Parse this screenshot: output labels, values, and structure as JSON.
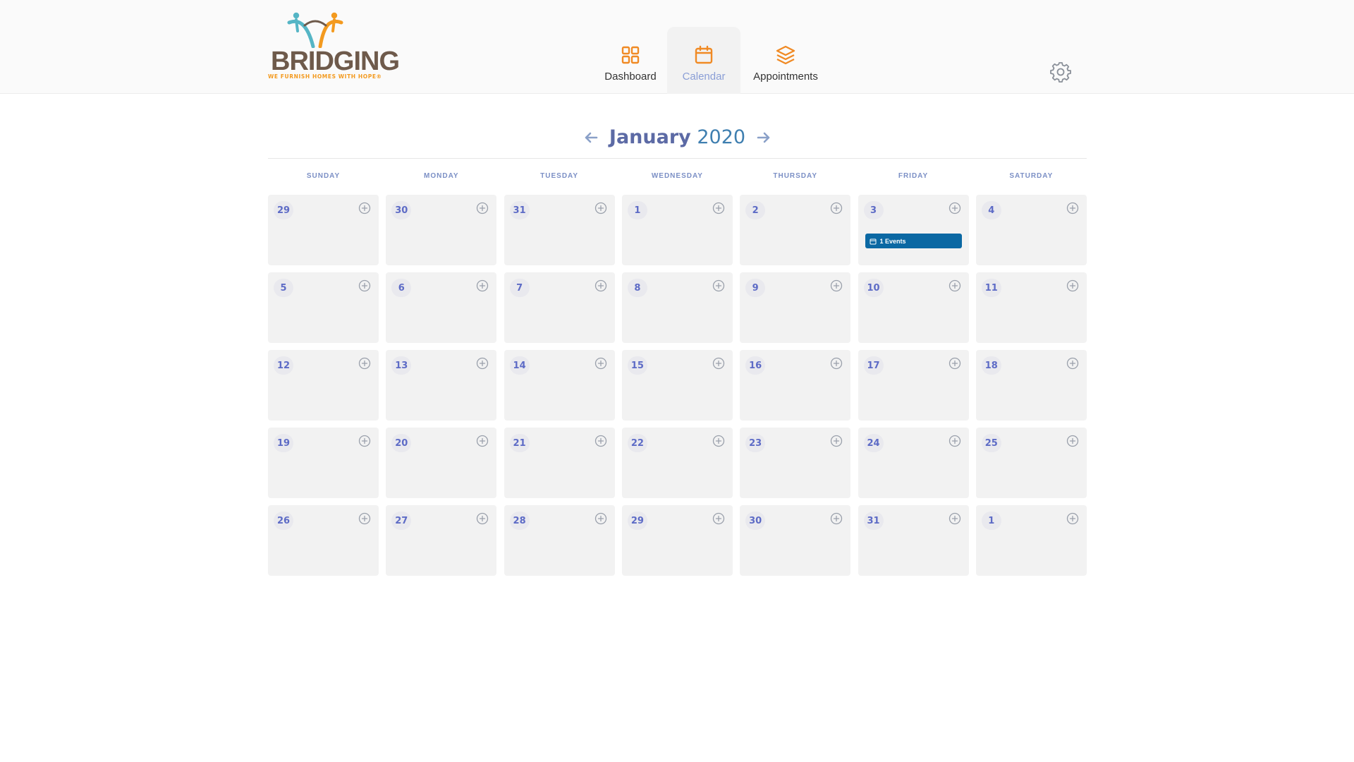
{
  "brand": {
    "name": "BRIDGING",
    "tagline": "WE FURNISH HOMES WITH HOPE®",
    "colors": {
      "brown": "#6e5a4b",
      "teal": "#55b5c5",
      "orange": "#f39a1f"
    }
  },
  "nav": {
    "items": [
      {
        "label": "Dashboard",
        "icon": "grid-icon",
        "active": false
      },
      {
        "label": "Calendar",
        "icon": "calendar-icon",
        "active": true
      },
      {
        "label": "Appointments",
        "icon": "layers-icon",
        "active": false
      }
    ],
    "settings_icon": "gear-icon"
  },
  "calendar": {
    "month": "January",
    "year": "2020",
    "weekdays": [
      "SUNDAY",
      "MONDAY",
      "TUESDAY",
      "WEDNESDAY",
      "THURSDAY",
      "FRIDAY",
      "SATURDAY"
    ],
    "weeks": [
      [
        "29",
        "30",
        "31",
        "1",
        "2",
        "3",
        "4"
      ],
      [
        "5",
        "6",
        "7",
        "8",
        "9",
        "10",
        "11"
      ],
      [
        "12",
        "13",
        "14",
        "15",
        "16",
        "17",
        "18"
      ],
      [
        "19",
        "20",
        "21",
        "22",
        "23",
        "24",
        "25"
      ],
      [
        "26",
        "27",
        "28",
        "29",
        "30",
        "31",
        "1"
      ]
    ],
    "events": [
      {
        "week": 0,
        "weekday": 5,
        "label": "1 Events",
        "color": "#0b68a3"
      }
    ],
    "accent_colors": {
      "day_number": "#5d6bc6",
      "weekday": "#7b8fc5",
      "orange": "#f39a1f"
    }
  }
}
